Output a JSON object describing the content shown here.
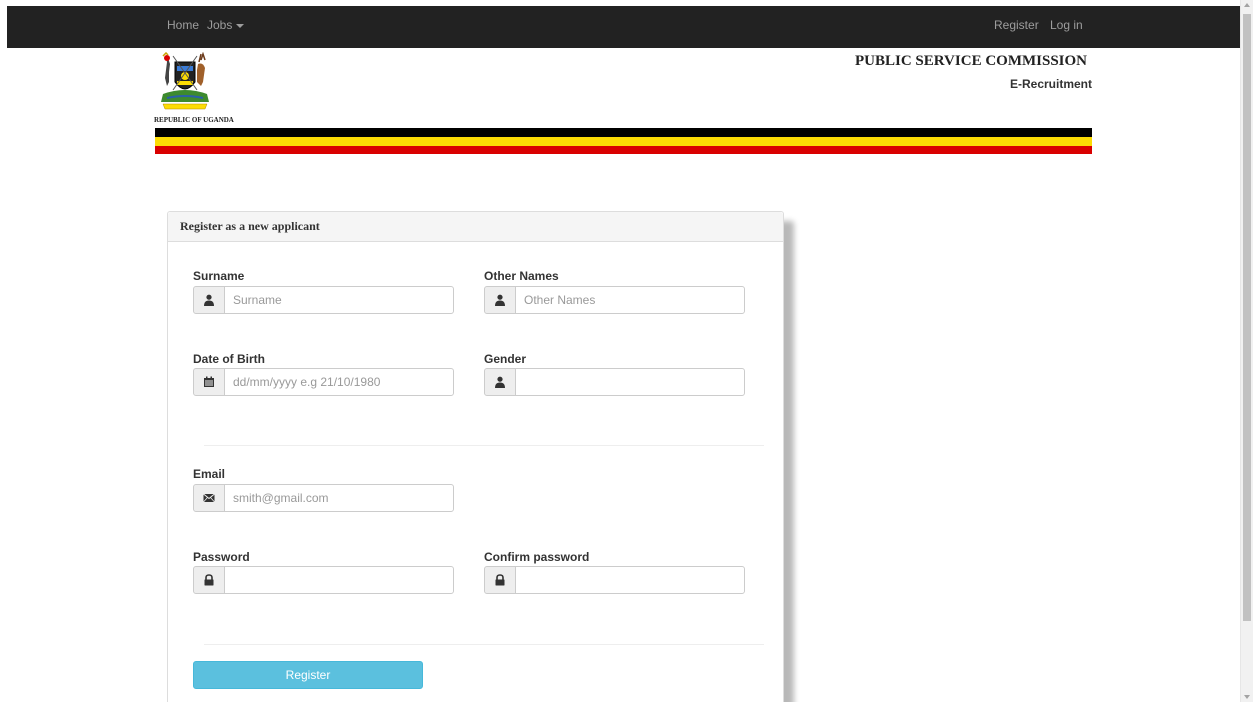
{
  "colors": {
    "navbar_bg": "#222222",
    "nav_text": "#9d9d9d",
    "flag_black": "#000000",
    "flag_yellow": "#fcdc04",
    "flag_red": "#d90000",
    "button_bg": "#5bc0de"
  },
  "navbar": {
    "home_label": "Home",
    "jobs_label": "Jobs",
    "register_label": "Register",
    "login_label": "Log in"
  },
  "header": {
    "crest_icon": "coat-of-arms-icon",
    "republic_label": "REPUBLIC OF UGANDA",
    "org_title": "PUBLIC SERVICE COMMISSION",
    "org_subtitle": "E-Recruitment"
  },
  "form": {
    "title": "Register as a new applicant",
    "surname": {
      "label": "Surname",
      "placeholder": "Surname",
      "value": "",
      "icon": "user-icon"
    },
    "other_names": {
      "label": "Other Names",
      "placeholder": "Other Names",
      "value": "",
      "icon": "user-icon"
    },
    "dob": {
      "label": "Date of Birth",
      "placeholder": "dd/mm/yyyy e.g 21/10/1980",
      "value": "",
      "icon": "calendar-icon"
    },
    "gender": {
      "label": "Gender",
      "placeholder": "",
      "value": "",
      "icon": "user-icon"
    },
    "email": {
      "label": "Email",
      "placeholder": "smith@gmail.com",
      "value": "",
      "icon": "envelope-icon"
    },
    "password": {
      "label": "Password",
      "placeholder": "",
      "value": "",
      "icon": "lock-icon"
    },
    "confirm_password": {
      "label": "Confirm password",
      "placeholder": "",
      "value": "",
      "icon": "lock-icon"
    },
    "submit_label": "Register"
  }
}
